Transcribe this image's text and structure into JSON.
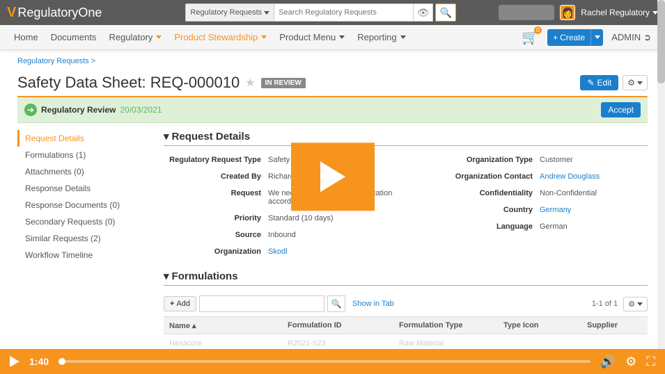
{
  "topbar": {
    "logo": "RegulatoryOne",
    "search_scope": "Regulatory Requests",
    "search_placeholder": "Search Regulatory Requests",
    "user_name": "Rachel Regulatory"
  },
  "nav": {
    "items": [
      "Home",
      "Documents",
      "Regulatory",
      "Product Stewardship",
      "Product Menu",
      "Reporting"
    ],
    "create": "Create",
    "admin": "ADMIN",
    "cart_count": "0"
  },
  "breadcrumb": "Regulatory Requests >",
  "page": {
    "title": "Safety Data Sheet: REQ-000010",
    "status": "IN REVIEW",
    "edit": "Edit"
  },
  "banner": {
    "label": "Regulatory Review",
    "date": "20/03/2021",
    "action": "Accept"
  },
  "sidebar": {
    "items": [
      {
        "label": "Request Details",
        "count": ""
      },
      {
        "label": "Formulations",
        "count": "(1)"
      },
      {
        "label": "Attachments",
        "count": "(0)"
      },
      {
        "label": "Response Details",
        "count": ""
      },
      {
        "label": "Response Documents",
        "count": "(0)"
      },
      {
        "label": "Secondary Requests",
        "count": "(0)"
      },
      {
        "label": "Similar Requests",
        "count": "(2)"
      },
      {
        "label": "Workflow Timeline",
        "count": ""
      }
    ]
  },
  "sections": {
    "details_title": "Request Details",
    "formulations_title": "Formulations"
  },
  "details": {
    "left": [
      {
        "label": "Regulatory Request Type",
        "value": "Safety Data Sheet",
        "link": false
      },
      {
        "label": "Created By",
        "value": "Richard Requester",
        "link": false
      },
      {
        "label": "Request",
        "value": "We need the SDS with Classification according latest EC Regulation",
        "link": false
      },
      {
        "label": "Priority",
        "value": "Standard (10 days)",
        "link": false
      },
      {
        "label": "Source",
        "value": "Inbound",
        "link": false
      },
      {
        "label": "Organization",
        "value": "Skodl",
        "link": true
      }
    ],
    "right": [
      {
        "label": "Organization Type",
        "value": "Customer",
        "link": false
      },
      {
        "label": "Organization Contact",
        "value": "Andrew Douglass",
        "link": true
      },
      {
        "label": "Confidentiality",
        "value": "Non-Confidential",
        "link": false
      },
      {
        "label": "Country",
        "value": "Germany",
        "link": true
      },
      {
        "label": "Language",
        "value": "German",
        "link": false
      }
    ]
  },
  "formulations": {
    "add": "Add",
    "show_tab": "Show in Tab",
    "pager": "1-1 of 1",
    "columns": [
      "Name",
      "Formulation ID",
      "Formulation Type",
      "Type Icon",
      "Supplier"
    ],
    "row": [
      "Hexacore",
      "R2021-523",
      "Raw Material",
      "",
      ""
    ]
  },
  "player": {
    "time": "1:40"
  }
}
